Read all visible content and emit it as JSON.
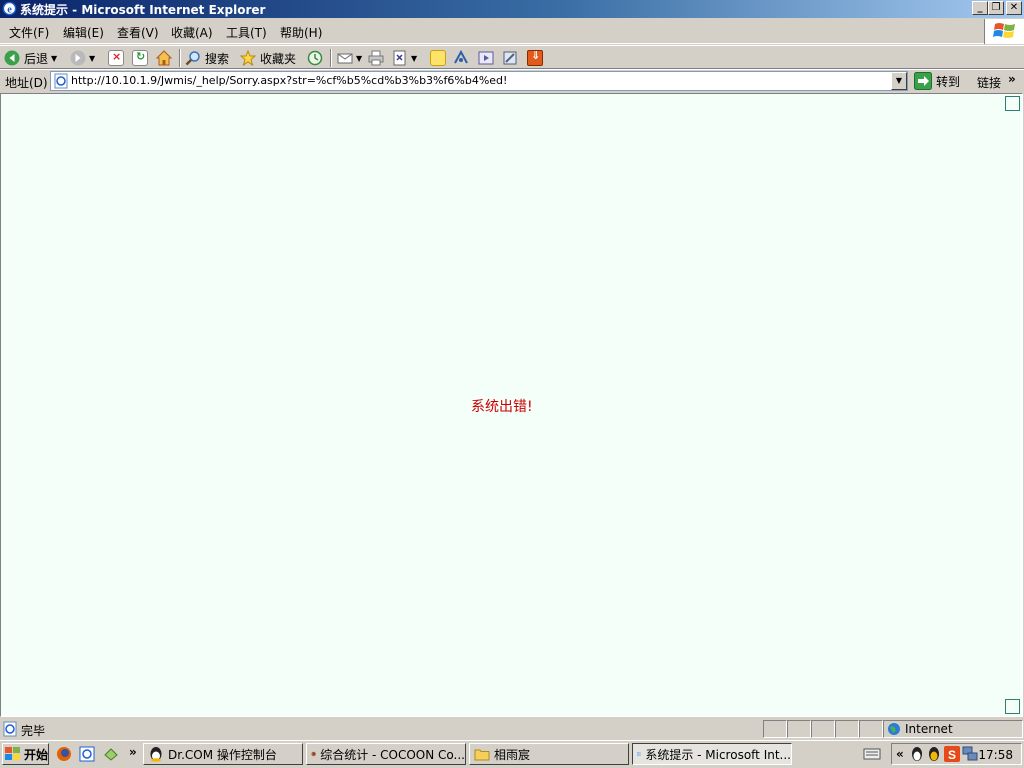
{
  "window": {
    "title": "系统提示 - Microsoft Internet Explorer",
    "controls": {
      "minimize": "_",
      "restore": "❐",
      "close": "✕"
    }
  },
  "menu": {
    "items": [
      "文件(F)",
      "编辑(E)",
      "查看(V)",
      "收藏(A)",
      "工具(T)",
      "帮助(H)"
    ]
  },
  "toolbar": {
    "back_label": "后退",
    "search_label": "搜索",
    "favorites_label": "收藏夹"
  },
  "address": {
    "label": "地址(D)",
    "url": "http://10.10.1.9/Jwmis/_help/Sorry.aspx?str=%cf%b5%cd%b3%b3%f6%b4%ed!",
    "go_label": "转到",
    "links_label": "链接",
    "links_chevron": "»"
  },
  "page": {
    "message": "系统出错!",
    "background": "#f4fffa",
    "message_color": "#cc0000"
  },
  "status": {
    "text": "完毕",
    "zone": "Internet"
  },
  "taskbar": {
    "start_label": "开始",
    "quicklaunch_chevron": "»",
    "tasks": [
      {
        "label": "Dr.COM 操作控制台",
        "icon": "qq-icon"
      },
      {
        "label": "综合统计 - COCOON Co...",
        "icon": "firefox-icon"
      },
      {
        "label": "相雨宸",
        "icon": "folder-icon"
      },
      {
        "label": "系统提示 - Microsoft Int...",
        "icon": "ie-icon",
        "active": true
      }
    ],
    "tray_chevron": "«",
    "clock": "17:58"
  }
}
